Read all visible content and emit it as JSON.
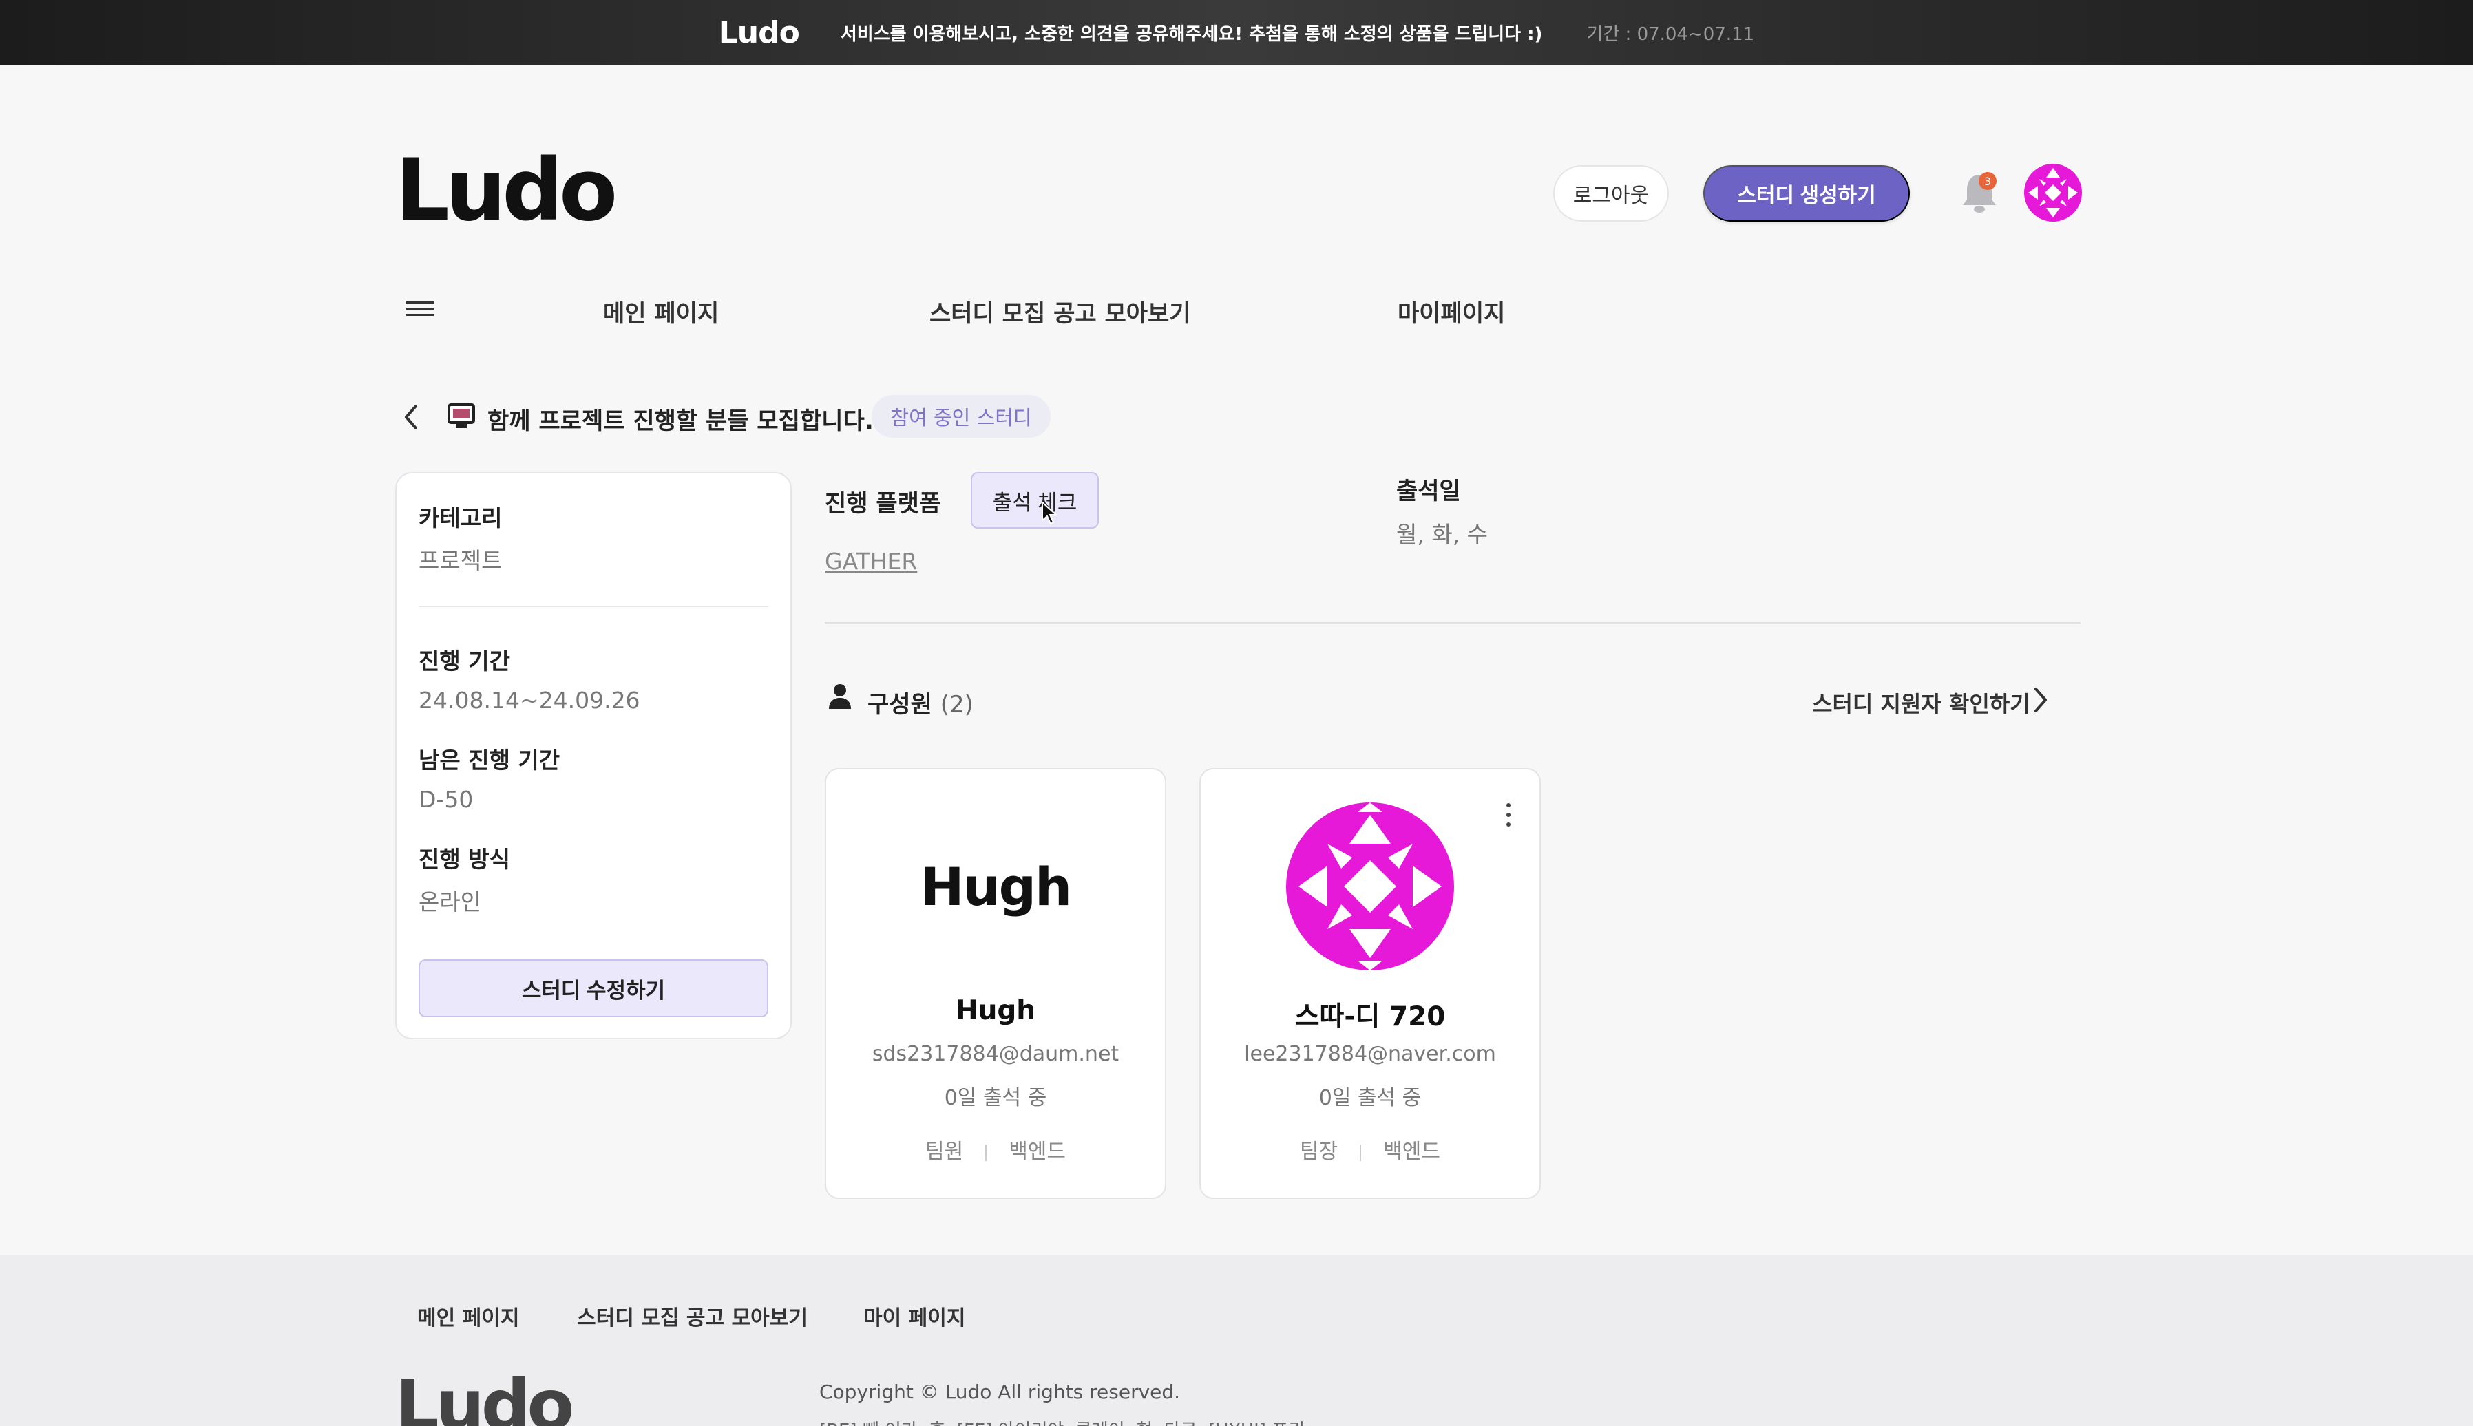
{
  "banner": {
    "logo": "Ludo",
    "message": "서비스를 이용해보시고, 소중한 의견을 공유해주세요! 추첨을 통해 소정의 상품을 드립니다 :)",
    "period": "기간 : 07.04~07.11"
  },
  "header": {
    "logo": "Ludo",
    "logout_label": "로그아웃",
    "create_label": "스터디 생성하기",
    "notification_count": "3"
  },
  "nav": {
    "items": [
      {
        "label": "메인 페이지"
      },
      {
        "label": "스터디 모집 공고 모아보기"
      },
      {
        "label": "마이페이지"
      }
    ]
  },
  "study": {
    "title": "함께 프로젝트 진행할 분들 모집합니다.",
    "status_badge": "참여 중인 스터디"
  },
  "info": {
    "category_label": "카테고리",
    "category_value": "프로젝트",
    "period_label": "진행 기간",
    "period_value": "24.08.14~24.09.26",
    "remaining_label": "남은 진행 기간",
    "remaining_value": "D-50",
    "method_label": "진행 방식",
    "method_value": "온라인",
    "edit_label": "스터디 수정하기"
  },
  "platform": {
    "label": "진행 플랫폼",
    "attendance_button": "출석 체크",
    "link": "GATHER"
  },
  "attendance_days": {
    "label": "출석일",
    "value": "월, 화, 수"
  },
  "members": {
    "title": "구성원",
    "count": "(2)",
    "applicants_link": "스터디 지원자 확인하기",
    "list": [
      {
        "avatar_text": "Hugh",
        "name": "Hugh",
        "email": "sds2317884@daum.net",
        "attendance": "0일 출석 중",
        "role": "팀원",
        "position": "백엔드"
      },
      {
        "avatar_text": "",
        "name": "스따-디 720",
        "email": "lee2317884@naver.com",
        "attendance": "0일 출석 중",
        "role": "팀장",
        "position": "백엔드"
      }
    ]
  },
  "footer": {
    "links": [
      {
        "label": "메인 페이지"
      },
      {
        "label": "스터디 모집 공고 모아보기"
      },
      {
        "label": "마이 페이지"
      }
    ],
    "logo": "Ludo",
    "copyright": "Copyright © Ludo All rights reserved.",
    "credits": "[BE] 빼 이가, 휴, [FE] 아이리야, 클레이, 혁, 다큐, [UXUI] 포귀"
  },
  "colors": {
    "accent": "#6c63c4",
    "accent_light": "#ebe8fb",
    "badge_text": "#7c75c8",
    "avatar_magenta": "#e619d9",
    "notification": "#e8653a"
  }
}
